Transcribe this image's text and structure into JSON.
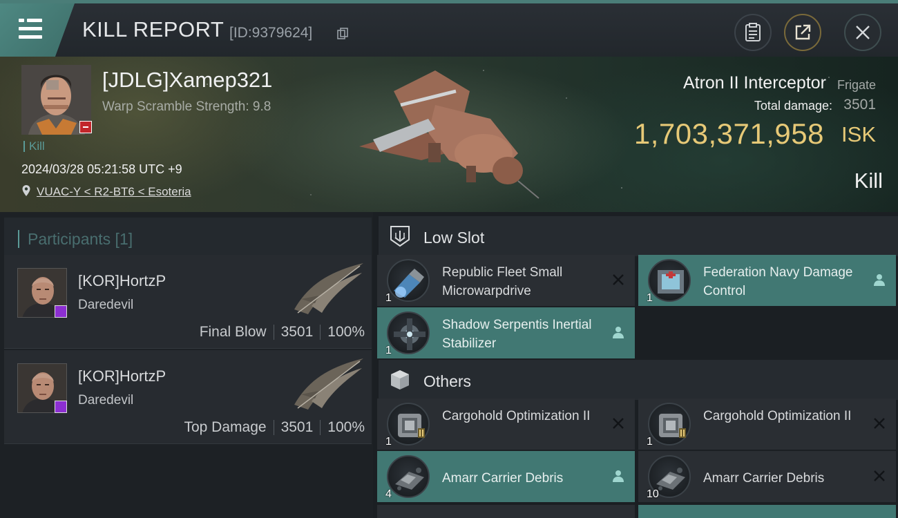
{
  "header": {
    "title": "KILL REPORT",
    "report_id": "[ID:9379624]",
    "icons": [
      "menu-icon",
      "copy-icon",
      "clipboard-icon",
      "share-icon",
      "close-icon"
    ]
  },
  "victim": {
    "name": "[JDLG]Xamep321",
    "warp_scramble": "Warp Scramble Strength: 9.8",
    "kill_tag": "Kill",
    "datetime": "2024/03/28 05:21:58 UTC +9",
    "location": "VUAC-Y < R2-BT6 < Esoteria",
    "ship_name": "Atron II Interceptor",
    "ship_class": "Frigate",
    "total_damage_label": "Total damage:",
    "total_damage": "3501",
    "isk_value": "1,703,371,958",
    "isk_unit": "ISK",
    "kill_type": "Kill"
  },
  "participants": {
    "title": "Participants [1]",
    "rows": [
      {
        "name": "[KOR]HortzP",
        "ship": "Daredevil",
        "role": "Final Blow",
        "damage": "3501",
        "percent": "100%"
      },
      {
        "name": "[KOR]HortzP",
        "ship": "Daredevil",
        "role": "Top Damage",
        "damage": "3501",
        "percent": "100%"
      }
    ]
  },
  "sections": {
    "low_slot": {
      "title": "Low Slot",
      "icon": "low-slot-icon"
    },
    "others": {
      "title": "Others",
      "icon": "cargo-box-icon"
    }
  },
  "low_slot_items": [
    {
      "name": "Republic Fleet Small Microwarpdrive",
      "qty": "1",
      "status": "destroyed"
    },
    {
      "name": "Federation Navy Damage Control",
      "qty": "1",
      "status": "dropped"
    },
    {
      "name": "Shadow Serpentis Inertial Stabilizer",
      "qty": "1",
      "status": "dropped"
    }
  ],
  "other_items": [
    {
      "name": "Cargohold Optimization II",
      "qty": "1",
      "status": "destroyed"
    },
    {
      "name": "Cargohold Optimization II",
      "qty": "1",
      "status": "destroyed"
    },
    {
      "name": "Amarr Carrier Debris",
      "qty": "4",
      "status": "dropped"
    },
    {
      "name": "Amarr Carrier Debris",
      "qty": "10",
      "status": "destroyed"
    }
  ],
  "colors": {
    "accent_teal": "#417873",
    "isk_gold": "#e7c977",
    "loss_red": "#c2262b",
    "corp_purple": "#8c2fd1"
  }
}
